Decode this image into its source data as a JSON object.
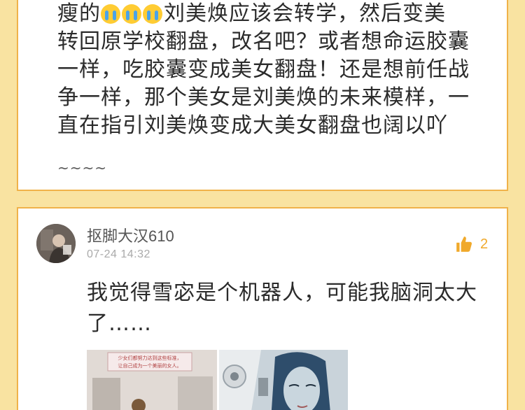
{
  "post": {
    "line1": "刘美焕应该会转学，然后变美",
    "line1_prefix": "瘦的",
    "line2": "转回原学校翻盘，改名吧？或者想命运胶囊",
    "line3": "一样，吃胶囊变成美女翻盘！还是想前任战",
    "line4": "争一样，那个美女是刘美焕的未来模样，一",
    "line5": "直在指引刘美焕变成大美女翻盘也阔以吖",
    "line6": "~~~~",
    "emoji_count": 3
  },
  "comment": {
    "username": "抠脚大汉610",
    "timestamp": "07-24 14:32",
    "like_count": "2",
    "text": "我觉得雪宓是个机器人，可能我脑洞太大了……",
    "thumb1_caption_a": "少女们都努力达到这些标准，",
    "thumb1_caption_b": "让自己成为一个美丽的女人。"
  },
  "colors": {
    "background": "#f9e3a1",
    "card_border": "#f0b24a",
    "like_accent": "#f0a92b"
  }
}
